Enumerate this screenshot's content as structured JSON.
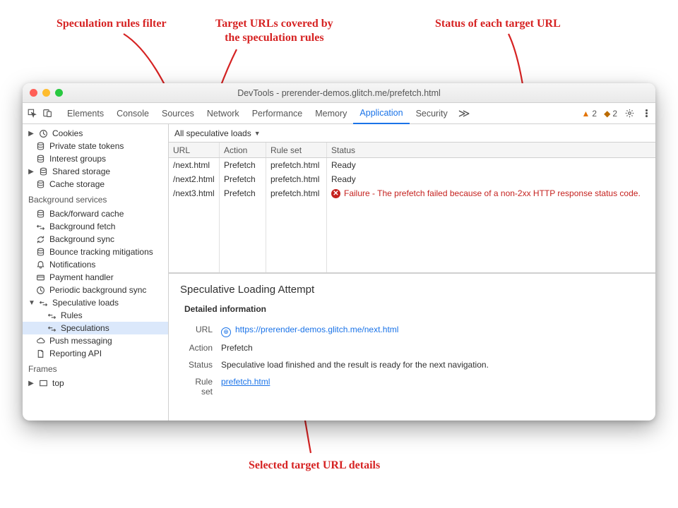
{
  "annotations": {
    "filter": "Speculation rules filter",
    "urls": "Target URLs covered by\nthe speculation rules",
    "status": "Status of each target URL",
    "details": "Selected target URL details"
  },
  "window": {
    "title": "DevTools - prerender-demos.glitch.me/prefetch.html"
  },
  "tabs": {
    "items": [
      "Elements",
      "Console",
      "Sources",
      "Network",
      "Performance",
      "Memory",
      "Application",
      "Security"
    ],
    "active": "Application",
    "overflow": "≫",
    "warnings_triangle": "2",
    "warnings_square": "2"
  },
  "sidebar": {
    "storage": [
      {
        "label": "Cookies",
        "arrow": true,
        "icon": "clock"
      },
      {
        "label": "Private state tokens",
        "icon": "db"
      },
      {
        "label": "Interest groups",
        "icon": "db"
      },
      {
        "label": "Shared storage",
        "arrow": true,
        "icon": "db"
      },
      {
        "label": "Cache storage",
        "icon": "db"
      }
    ],
    "bg_title": "Background services",
    "bg": [
      {
        "label": "Back/forward cache",
        "icon": "db"
      },
      {
        "label": "Background fetch",
        "icon": "arrows"
      },
      {
        "label": "Background sync",
        "icon": "sync"
      },
      {
        "label": "Bounce tracking mitigations",
        "icon": "db"
      },
      {
        "label": "Notifications",
        "icon": "bell"
      },
      {
        "label": "Payment handler",
        "icon": "card"
      },
      {
        "label": "Periodic background sync",
        "icon": "clock"
      },
      {
        "label": "Speculative loads",
        "icon": "arrows",
        "arrow": true,
        "open": true
      },
      {
        "label": "Rules",
        "icon": "arrows",
        "indent": true
      },
      {
        "label": "Speculations",
        "icon": "arrows",
        "indent": true,
        "selected": true
      },
      {
        "label": "Push messaging",
        "icon": "cloud"
      },
      {
        "label": "Reporting API",
        "icon": "doc"
      }
    ],
    "frames_title": "Frames",
    "frames": [
      {
        "label": "top",
        "icon": "frame",
        "arrow": true
      }
    ]
  },
  "filter": {
    "label": "All speculative loads"
  },
  "table": {
    "columns": [
      "URL",
      "Action",
      "Rule set",
      "Status"
    ],
    "rows": [
      {
        "url": "/next.html",
        "action": "Prefetch",
        "ruleset": "prefetch.html",
        "status": "Ready",
        "fail": false
      },
      {
        "url": "/next2.html",
        "action": "Prefetch",
        "ruleset": "prefetch.html",
        "status": "Ready",
        "fail": false
      },
      {
        "url": "/next3.html",
        "action": "Prefetch",
        "ruleset": "prefetch.html",
        "status": "Failure - The prefetch failed because of a non-2xx HTTP response status code.",
        "fail": true
      }
    ]
  },
  "detail": {
    "heading": "Speculative Loading Attempt",
    "subheading": "Detailed information",
    "url_label": "URL",
    "url_value": "https://prerender-demos.glitch.me/next.html",
    "action_label": "Action",
    "action_value": "Prefetch",
    "status_label": "Status",
    "status_value": "Speculative load finished and the result is ready for the next navigation.",
    "ruleset_label": "Rule set",
    "ruleset_value": "prefetch.html"
  }
}
